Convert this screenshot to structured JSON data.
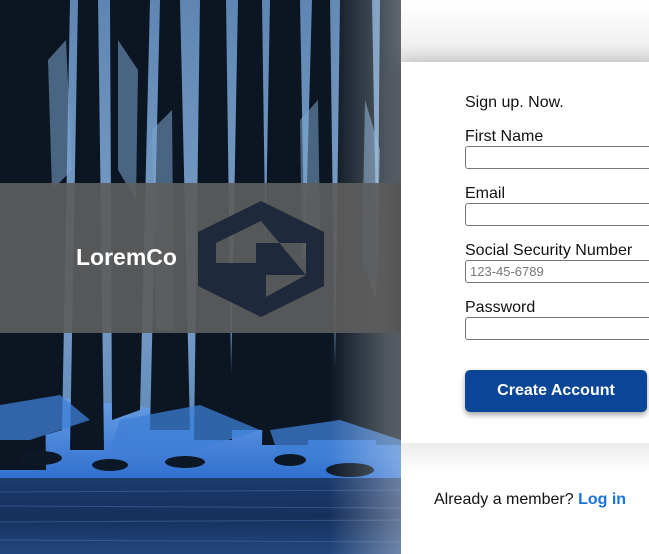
{
  "brand": {
    "name": "LoremCo",
    "logo_icon": "hexagon-s-logo-icon"
  },
  "form": {
    "heading": "Sign up. Now.",
    "fields": [
      {
        "label": "First Name",
        "value": "",
        "placeholder": ""
      },
      {
        "label": "Email",
        "value": "",
        "placeholder": ""
      },
      {
        "label": "Social Security Number",
        "value": "",
        "placeholder": "123-45-6789"
      },
      {
        "label": "Password",
        "value": "",
        "placeholder": ""
      }
    ],
    "submit_label": "Create Account"
  },
  "footer": {
    "prompt": "Already a member?",
    "link_label": "Log in"
  },
  "colors": {
    "button": "#0a4598",
    "link": "#1a73d9",
    "brand_band": "#5c5c5c",
    "logo": "#1e2a3c"
  }
}
